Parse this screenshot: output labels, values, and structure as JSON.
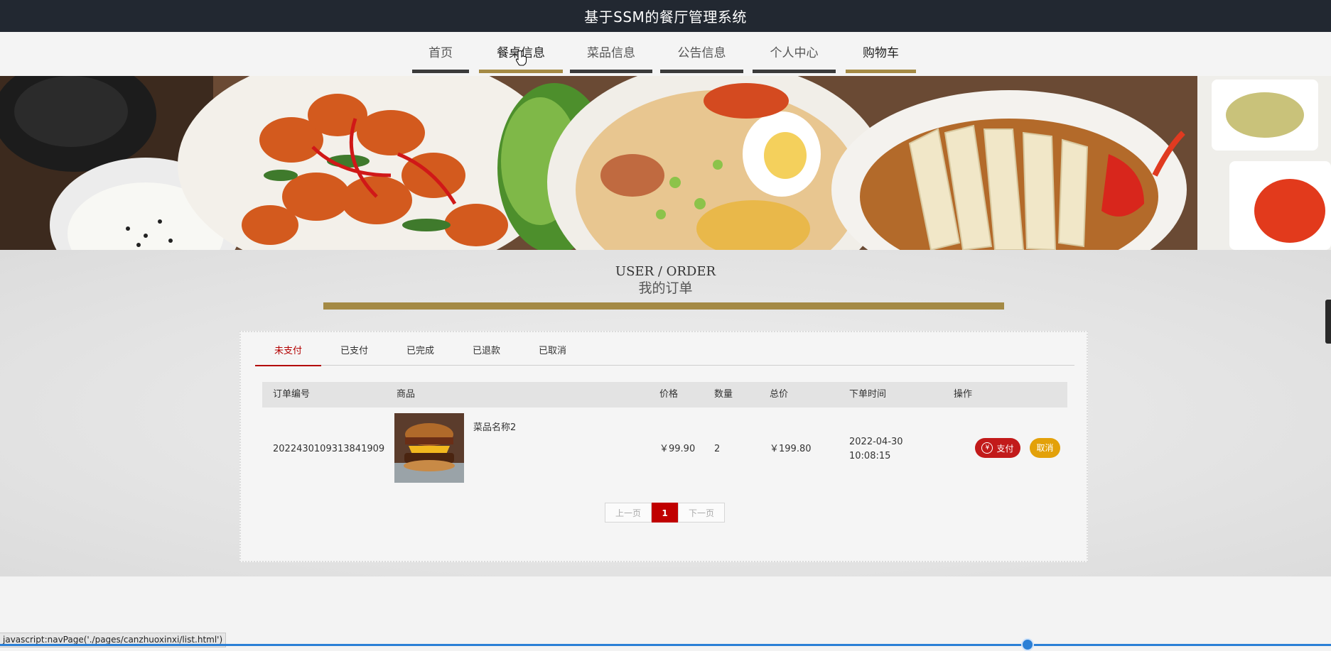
{
  "app": {
    "title": "基于SSM的餐厅管理系统"
  },
  "nav": [
    {
      "label": "首页"
    },
    {
      "label": "餐桌信息"
    },
    {
      "label": "菜品信息"
    },
    {
      "label": "公告信息"
    },
    {
      "label": "个人中心"
    },
    {
      "label": "购物车"
    }
  ],
  "section": {
    "title_en": "USER / ORDER",
    "title_cn": "我的订单"
  },
  "tabs": [
    {
      "label": "未支付"
    },
    {
      "label": "已支付"
    },
    {
      "label": "已完成"
    },
    {
      "label": "已退款"
    },
    {
      "label": "已取消"
    }
  ],
  "table": {
    "headers": [
      "订单编号",
      "商品",
      "价格",
      "数量",
      "总价",
      "下单时间",
      "操作"
    ],
    "rows": [
      {
        "order_no": "2022430109313841909",
        "product_name": "菜品名称2",
        "price": "￥99.90",
        "quantity": "2",
        "total": "￥199.80",
        "date": "2022-04-30",
        "time": "10:08:15",
        "pay_label": "支付",
        "pay_icon": "¥",
        "cancel_label": "取消"
      }
    ]
  },
  "pager": {
    "prev": "上一页",
    "current": "1",
    "next": "下一页"
  },
  "status": {
    "url": "javascript:navPage('./pages/canzhuoxinxi/list.html')"
  },
  "colors": {
    "gold": "#a48a45",
    "red": "#c21a1a",
    "orange": "#e3a10a",
    "topbar": "#222831"
  }
}
